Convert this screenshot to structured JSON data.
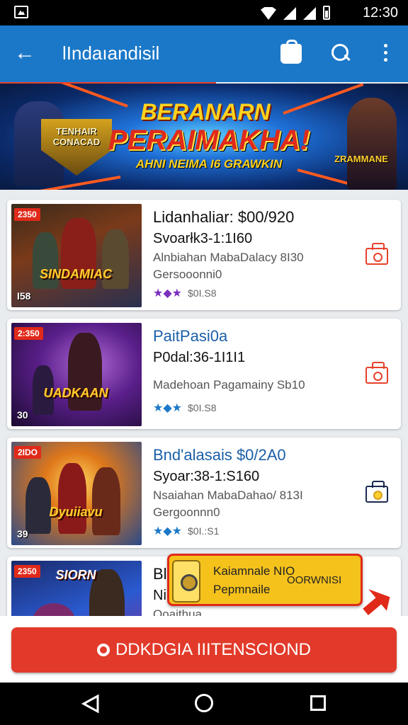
{
  "status_bar": {
    "time": "12:30"
  },
  "app_bar": {
    "title": "lIndaıandisil"
  },
  "banner": {
    "headline_1": "BERANARN",
    "headline_2": "PERAIMAKHA!",
    "subtitle": "AHNI NEIMA I6 GRAWKIN",
    "left_logo_text": "TENHAIR CONACAD",
    "right_logo_text": "ZRAMMANE"
  },
  "games": [
    {
      "tag": "2350",
      "count": "I58",
      "art_title": "SINDAMIAC",
      "name": "Lidanhaliar: $00/920",
      "line2": "Svoarłk3-1:1I60",
      "line3": "Alnbiahan MabaDalacy 8I30",
      "line4": "Gersooonni0",
      "rating": "$0I.S8",
      "star_color": "#7b2fbf"
    },
    {
      "tag": "2:350",
      "count": "30",
      "art_title": "UADKAAN",
      "name": "PaitPasi0a",
      "line2": "P0dal:36-1I1I1",
      "line3": "Madehoan Pagamainy Sb10",
      "line4": "",
      "rating": "$0I.S8",
      "star_color": "#1b78c8"
    },
    {
      "tag": "2IDO",
      "count": "39",
      "art_title": "Dyuiiavu",
      "name": "Bnd'alasais $0/2A0",
      "line2": "Syoar:38-1:S160",
      "line3": "Nsaiahan MabaDahao/ 813I",
      "line4": "Gergoonnn0",
      "rating": "$0I.:S1",
      "star_color": "#1b78c8"
    },
    {
      "tag": "2350",
      "count": "",
      "art_title": "SIORN",
      "name": "Bl",
      "line2": "Ni",
      "line3": "Ooaithua",
      "line4": "",
      "rating": "",
      "star_color": "#1b78c8"
    }
  ],
  "toast": {
    "line1": "Kaiamnale NIO",
    "line2": "Pepmnaile",
    "right_text": "OORWNISI"
  },
  "cta": {
    "label": "DDKDGIA IIITENSCIOND"
  },
  "colors": {
    "app_bar": "#1b78c8",
    "accent": "#e23a2a",
    "toast": "#f5c21c"
  }
}
